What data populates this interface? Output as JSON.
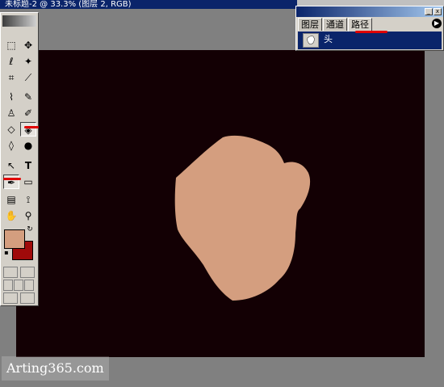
{
  "window": {
    "title": "未标题-2 @ 33.3% (图层 2, RGB)"
  },
  "palette": {
    "tabs": [
      "图层",
      "通道",
      "路径"
    ],
    "active_tab": "路径",
    "paths": [
      {
        "label": "头"
      }
    ],
    "buttons": {
      "minimize": "_",
      "close": "x"
    }
  },
  "toolbox": {
    "tools": [
      "marquee",
      "move",
      "lasso",
      "magic-wand",
      "crop",
      "slice",
      "healing-brush",
      "brush",
      "clone-stamp",
      "history-brush",
      "eraser",
      "paint-bucket",
      "blur",
      "burn",
      "path-selection",
      "type",
      "pen",
      "rectangle",
      "notes",
      "eyedropper",
      "hand",
      "zoom"
    ],
    "foreground_color": "#d49e7f",
    "background_color": "#a00a0a"
  },
  "canvas": {
    "background_color": "#130004",
    "shape_color": "#d49e7f",
    "shape_name": "头"
  },
  "watermark": {
    "text": "Arting365.com"
  },
  "colors": {
    "highlight": "#e00000",
    "selection": "#0a246a"
  }
}
